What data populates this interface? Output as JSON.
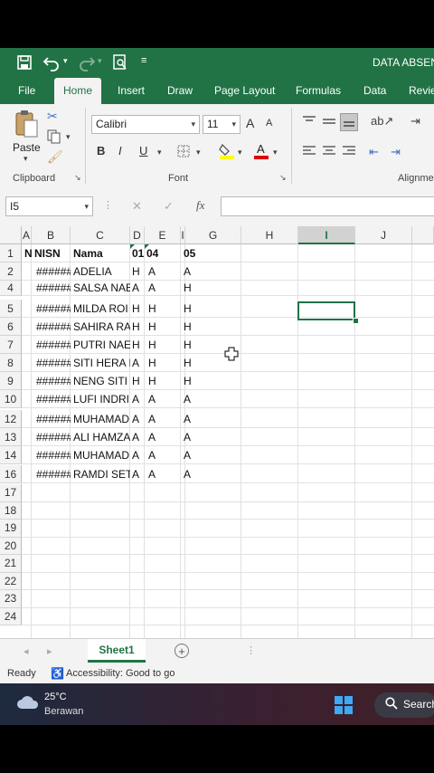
{
  "titlebar": {
    "doc_title": "DATA ABSENS"
  },
  "tabs": [
    {
      "label": "File"
    },
    {
      "label": "Home"
    },
    {
      "label": "Insert"
    },
    {
      "label": "Draw"
    },
    {
      "label": "Page Layout"
    },
    {
      "label": "Formulas"
    },
    {
      "label": "Data"
    },
    {
      "label": "Revie"
    }
  ],
  "ribbon": {
    "paste_label": "Paste",
    "clipboard_group": "Clipboard",
    "font_name": "Calibri",
    "font_size": "11",
    "font_group": "Font",
    "align_group": "Alignme",
    "bold": "B",
    "italic": "I",
    "underline": "U",
    "grow_font": "A",
    "shrink_font": "A",
    "font_color_glyph": "A"
  },
  "formula_bar": {
    "name_box": "I5",
    "fx": "fx",
    "cancel": "✕",
    "enter": "✓",
    "value": ""
  },
  "columns": [
    {
      "letter": "A"
    },
    {
      "letter": "B"
    },
    {
      "letter": "C"
    },
    {
      "letter": "D"
    },
    {
      "letter": "E"
    },
    {
      "letter": "I"
    },
    {
      "letter": "G"
    },
    {
      "letter": "H"
    },
    {
      "letter": "I"
    },
    {
      "letter": "J"
    }
  ],
  "header_row": {
    "num": "1",
    "a": "N",
    "b": "NISN",
    "c": "Nama",
    "d": "01",
    "e": "04",
    "f": "05"
  },
  "rows": [
    {
      "num": "2",
      "b": "######",
      "c": "ADELIA",
      "d": "H",
      "e": "A",
      "f": "A"
    },
    {
      "num": "4",
      "b": "######",
      "c": "SALSA NAE",
      "d": "A",
      "e": "A",
      "f": "H"
    },
    {
      "num": "5",
      "b": "######",
      "c": "MILDA ROI",
      "d": "H",
      "e": "H",
      "f": "H"
    },
    {
      "num": "6",
      "b": "######",
      "c": "SAHIRA RA",
      "d": "H",
      "e": "H",
      "f": "H"
    },
    {
      "num": "7",
      "b": "######",
      "c": "PUTRI NAE",
      "d": "H",
      "e": "H",
      "f": "H"
    },
    {
      "num": "8",
      "b": "######",
      "c": "SITI HERA I",
      "d": "A",
      "e": "H",
      "f": "H"
    },
    {
      "num": "9",
      "b": "######",
      "c": "NENG SITI",
      "d": "H",
      "e": "H",
      "f": "H"
    },
    {
      "num": "10",
      "b": "######",
      "c": "LUFI INDRI",
      "d": "A",
      "e": "A",
      "f": "A"
    },
    {
      "num": "12",
      "b": "######",
      "c": "MUHAMAD",
      "d": "A",
      "e": "A",
      "f": "A"
    },
    {
      "num": "13",
      "b": "######",
      "c": "ALI HAMZA",
      "d": "A",
      "e": "A",
      "f": "A"
    },
    {
      "num": "14",
      "b": "######",
      "c": "MUHAMAD",
      "d": "A",
      "e": "A",
      "f": "A"
    },
    {
      "num": "16",
      "b": "######",
      "c": "RAMDI SET",
      "d": "A",
      "e": "A",
      "f": "A"
    }
  ],
  "empty_rows": [
    "17",
    "18",
    "19",
    "20",
    "21",
    "22",
    "23",
    "24"
  ],
  "sheet_tab": "Sheet1",
  "status": {
    "ready": "Ready",
    "accessibility": "Accessibility: Good to go"
  },
  "taskbar": {
    "temp": "25°C",
    "weather": "Berawan",
    "search": "Search"
  },
  "colors": {
    "excel_green": "#217346",
    "ribbon_bg": "#f3f3f3",
    "selected_cell": "#217346"
  }
}
